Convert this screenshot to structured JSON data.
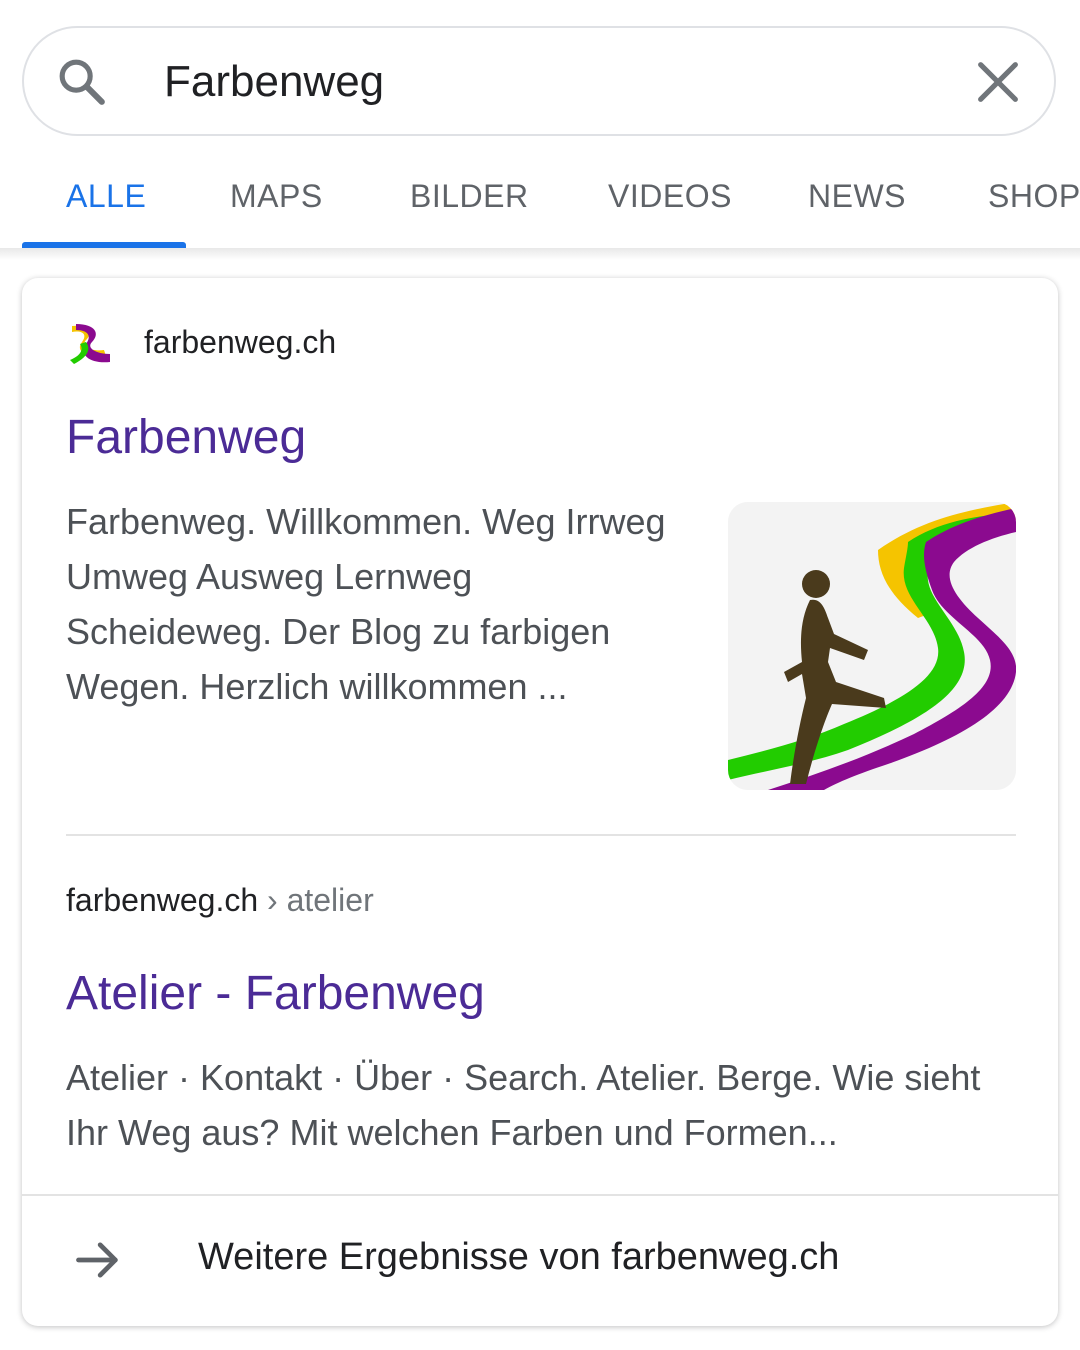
{
  "search": {
    "query": "Farbenweg",
    "icon": "search-icon",
    "clear_icon": "close-icon"
  },
  "tabs": [
    {
      "label": "ALLE",
      "active": true
    },
    {
      "label": "MAPS",
      "active": false
    },
    {
      "label": "BILDER",
      "active": false
    },
    {
      "label": "VIDEOS",
      "active": false
    },
    {
      "label": "NEWS",
      "active": false
    },
    {
      "label": "SHOPPING",
      "active": false
    }
  ],
  "results": [
    {
      "site": "farbenweg.ch",
      "favicon": "farbenweg-logo-icon",
      "title": "Farbenweg",
      "snippet": "Farbenweg. Willkommen. Weg Irrweg Umweg Ausweg Lernweg Scheideweg. Der Blog zu farbigen Wegen. Herzlich willkommen ...",
      "thumbnail": "farbenweg-walker-image"
    },
    {
      "breadcrumb_domain": "farbenweg.ch",
      "breadcrumb_separator": "›",
      "breadcrumb_path": "atelier",
      "title": "Atelier - Farbenweg",
      "snippet": "Atelier · Kontakt · Über · Search. Atelier. Berge. Wie sieht Ihr Weg aus? Mit welchen Farben und Formen..."
    }
  ],
  "more_results": {
    "label": "Weitere Ergebnisse von farbenweg.ch",
    "icon": "arrow-right-icon"
  },
  "colors": {
    "accent": "#1a73e8",
    "visited_link": "#4b2b96",
    "path_yellow": "#f5c400",
    "path_purple": "#8b0a8f",
    "path_green": "#22cc00",
    "figure_brown": "#4a3a1c"
  }
}
